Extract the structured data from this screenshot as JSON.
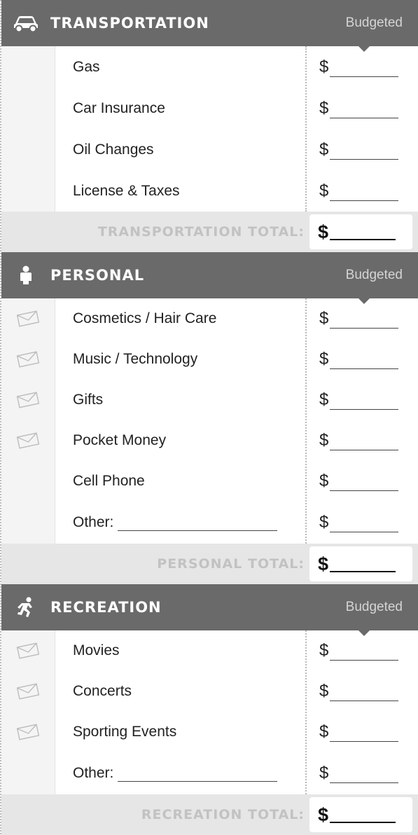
{
  "colors": {
    "header_bg": "#6a6a6a",
    "header_text": "#ffffff",
    "budget_label": "#d4d4d4",
    "total_band": "#e6e6e6",
    "total_label": "#c2c2c2"
  },
  "sections": [
    {
      "title": "TRANSPORTATION",
      "icon": "car-icon",
      "budget_label": "Budgeted",
      "rows": [
        {
          "label": "Gas",
          "currency": "$"
        },
        {
          "label": "Car Insurance",
          "currency": "$"
        },
        {
          "label": "Oil Changes",
          "currency": "$"
        },
        {
          "label": "License & Taxes",
          "currency": "$"
        }
      ],
      "total_label": "TRANSPORTATION TOTAL:",
      "total_currency": "$"
    },
    {
      "title": "PERSONAL",
      "icon": "person-icon",
      "budget_label": "Budgeted",
      "rows": [
        {
          "label": "Cosmetics / Hair Care",
          "currency": "$",
          "icon": "envelope-icon"
        },
        {
          "label": "Music / Technology",
          "currency": "$",
          "icon": "envelope-icon"
        },
        {
          "label": "Gifts",
          "currency": "$",
          "icon": "envelope-icon"
        },
        {
          "label": "Pocket Money",
          "currency": "$",
          "icon": "envelope-icon"
        },
        {
          "label": "Cell Phone",
          "currency": "$"
        },
        {
          "label": "Other:",
          "currency": "$"
        }
      ],
      "total_label": "PERSONAL TOTAL:",
      "total_currency": "$"
    },
    {
      "title": "RECREATION",
      "icon": "runner-icon",
      "budget_label": "Budgeted",
      "rows": [
        {
          "label": "Movies",
          "currency": "$",
          "icon": "envelope-icon"
        },
        {
          "label": "Concerts",
          "currency": "$",
          "icon": "envelope-icon"
        },
        {
          "label": "Sporting Events",
          "currency": "$",
          "icon": "envelope-icon"
        },
        {
          "label": "Other:",
          "currency": "$"
        }
      ],
      "total_label": "RECREATION TOTAL:",
      "total_currency": "$"
    }
  ]
}
